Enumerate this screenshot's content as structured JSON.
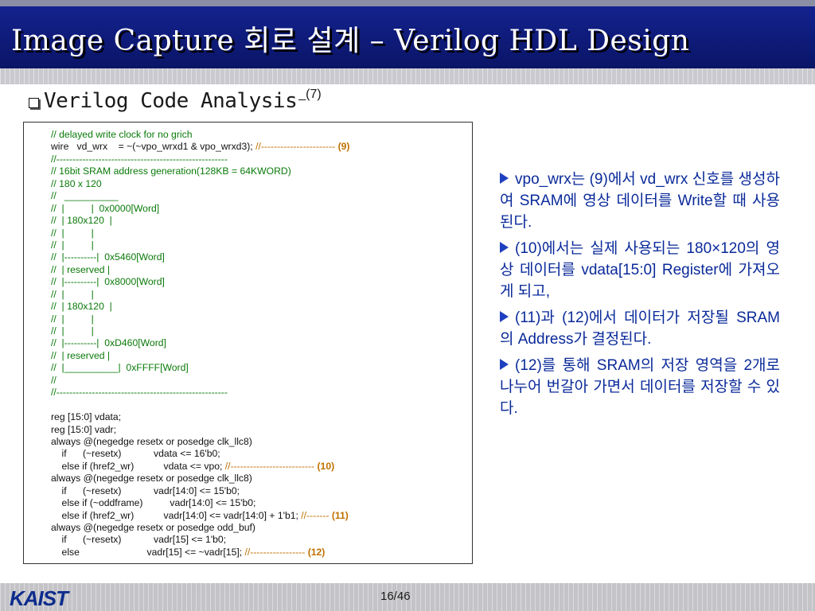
{
  "slide": {
    "title": "Image Capture 회로 설계 – Verilog HDL Design",
    "heading": "Verilog Code Analysis",
    "heading_sub": "_(7)",
    "page": "16/46",
    "logo": "KAIST"
  },
  "code_lines": [
    [
      {
        "c": "cmt",
        "t": "// delayed write clock for no grich"
      }
    ],
    [
      {
        "c": "",
        "t": "wire   vd_wrx    = ~(~vpo_wrxd1 & vpo_wrxd3); "
      },
      {
        "c": "dash",
        "t": "//----------------------- "
      },
      {
        "c": "ref",
        "t": "(9)"
      }
    ],
    [
      {
        "c": "cmt",
        "t": "//-----------------------------------------------------"
      }
    ],
    [
      {
        "c": "cmt",
        "t": "// 16bit SRAM address generation(128KB = 64KWORD)"
      }
    ],
    [
      {
        "c": "cmt",
        "t": "// 180 x 120"
      }
    ],
    [
      {
        "c": "cmt",
        "t": "//   __________"
      }
    ],
    [
      {
        "c": "cmt",
        "t": "//  |          |  0x0000[Word]"
      }
    ],
    [
      {
        "c": "cmt",
        "t": "//  | 180x120  |"
      }
    ],
    [
      {
        "c": "cmt",
        "t": "//  |          |"
      }
    ],
    [
      {
        "c": "cmt",
        "t": "//  |          |"
      }
    ],
    [
      {
        "c": "cmt",
        "t": "//  |----------|  0x5460[Word]"
      }
    ],
    [
      {
        "c": "cmt",
        "t": "//  | reserved |"
      }
    ],
    [
      {
        "c": "cmt",
        "t": "//  |----------|  0x8000[Word]"
      }
    ],
    [
      {
        "c": "cmt",
        "t": "//  |          |"
      }
    ],
    [
      {
        "c": "cmt",
        "t": "//  | 180x120  |"
      }
    ],
    [
      {
        "c": "cmt",
        "t": "//  |          |"
      }
    ],
    [
      {
        "c": "cmt",
        "t": "//  |          |"
      }
    ],
    [
      {
        "c": "cmt",
        "t": "//  |----------|  0xD460[Word]"
      }
    ],
    [
      {
        "c": "cmt",
        "t": "//  | reserved |"
      }
    ],
    [
      {
        "c": "cmt",
        "t": "//  |__________|  0xFFFF[Word]"
      }
    ],
    [
      {
        "c": "cmt",
        "t": "//"
      }
    ],
    [
      {
        "c": "cmt",
        "t": "//-----------------------------------------------------"
      }
    ],
    [
      {
        "c": "",
        "t": " "
      }
    ],
    [
      {
        "c": "",
        "t": "reg [15:0] vdata;"
      }
    ],
    [
      {
        "c": "",
        "t": "reg [15:0] vadr;"
      }
    ],
    [
      {
        "c": "",
        "t": "always @(negedge resetx or posedge clk_llc8)"
      }
    ],
    [
      {
        "c": "",
        "t": "    if      (~resetx)            vdata <= 16'b0;"
      }
    ],
    [
      {
        "c": "",
        "t": "    else if (href2_wr)           vdata <= vpo; "
      },
      {
        "c": "dash",
        "t": "//-------------------------- "
      },
      {
        "c": "ref",
        "t": "(10)"
      }
    ],
    [
      {
        "c": "",
        "t": "always @(negedge resetx or posedge clk_llc8)"
      }
    ],
    [
      {
        "c": "",
        "t": "    if      (~resetx)            vadr[14:0] <= 15'b0;"
      }
    ],
    [
      {
        "c": "",
        "t": "    else if (~oddframe)          vadr[14:0] <= 15'b0;"
      }
    ],
    [
      {
        "c": "",
        "t": "    else if (href2_wr)           vadr[14:0] <= vadr[14:0] + 1'b1; "
      },
      {
        "c": "dash",
        "t": "//------- "
      },
      {
        "c": "ref",
        "t": "(11)"
      }
    ],
    [
      {
        "c": "",
        "t": "always @(negedge resetx or posedge odd_buf)"
      }
    ],
    [
      {
        "c": "",
        "t": "    if      (~resetx)            vadr[15] <= 1'b0;"
      }
    ],
    [
      {
        "c": "",
        "t": "    else                         vadr[15] <= ~vadr[15]; "
      },
      {
        "c": "dash",
        "t": "//----------------- "
      },
      {
        "c": "ref",
        "t": "(12)"
      }
    ]
  ],
  "bullets": [
    "vpo_wrx는 (9)에서 vd_wrx 신호를 생성하여 SRAM에 영상 데이터를 Write할 때 사용된다.",
    "(10)에서는 실제 사용되는 180×120의 영상 데이터를 vdata[15:0] Register에 가져오게 되고,",
    "(11)과 (12)에서 데이터가 저장될 SRAM의 Address가 결정된다.",
    "(12)를 통해 SRAM의 저장 영역을 2개로 나누어 번갈아 가면서 데이터를 저장할 수 있다."
  ]
}
